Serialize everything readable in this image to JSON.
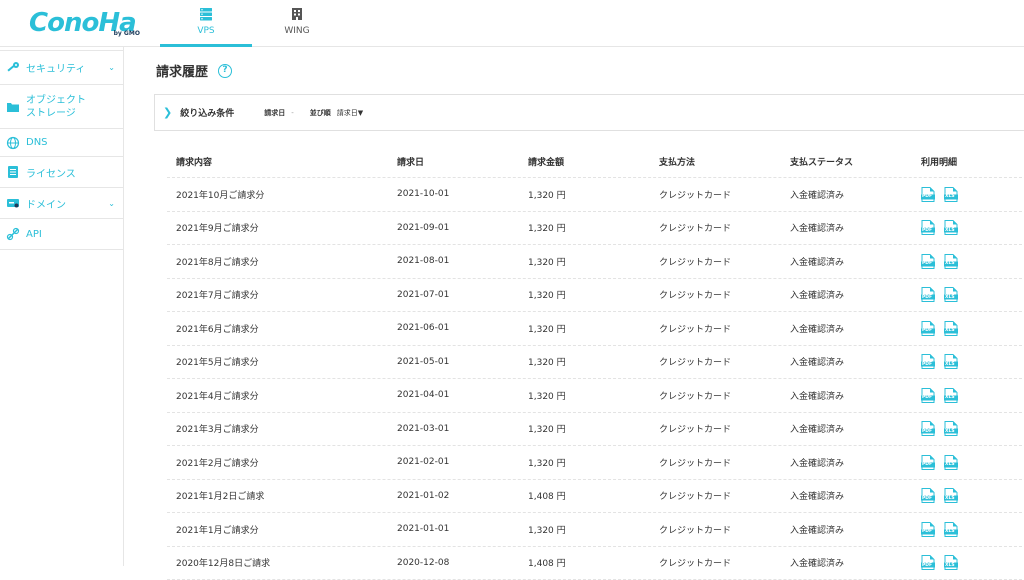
{
  "header": {
    "logo_text": "ConoHa",
    "logo_sub": "by GMO",
    "tabs": [
      {
        "label": "VPS",
        "icon": "server-icon",
        "active": true
      },
      {
        "label": "WING",
        "icon": "building-icon",
        "active": false
      }
    ]
  },
  "sidebar": {
    "items": [
      {
        "label": "セキュリティ",
        "icon": "key-icon",
        "has_chevron": true
      },
      {
        "label_line1": "オブジェクト",
        "label_line2": "ストレージ",
        "icon": "folder-icon"
      },
      {
        "label": "DNS",
        "icon": "globe-icon"
      },
      {
        "label": "ライセンス",
        "icon": "license-icon"
      },
      {
        "label": "ドメイン",
        "icon": "domain-icon",
        "has_chevron": true
      },
      {
        "label": "API",
        "icon": "api-icon"
      }
    ]
  },
  "main": {
    "title": "請求履歴",
    "help": "?",
    "filter": {
      "title": "絞り込み条件",
      "date_label": "請求日",
      "date_value": "-",
      "sort_label": "並び順",
      "sort_value": "請求日▼"
    },
    "table": {
      "headers": [
        "請求内容",
        "請求日",
        "請求金額",
        "支払方法",
        "支払ステータス",
        "利用明細"
      ],
      "rows": [
        [
          "2021年10月ご請求分",
          "2021-10-01",
          "1,320 円",
          "クレジットカード",
          "入金確認済み"
        ],
        [
          "2021年9月ご請求分",
          "2021-09-01",
          "1,320 円",
          "クレジットカード",
          "入金確認済み"
        ],
        [
          "2021年8月ご請求分",
          "2021-08-01",
          "1,320 円",
          "クレジットカード",
          "入金確認済み"
        ],
        [
          "2021年7月ご請求分",
          "2021-07-01",
          "1,320 円",
          "クレジットカード",
          "入金確認済み"
        ],
        [
          "2021年6月ご請求分",
          "2021-06-01",
          "1,320 円",
          "クレジットカード",
          "入金確認済み"
        ],
        [
          "2021年5月ご請求分",
          "2021-05-01",
          "1,320 円",
          "クレジットカード",
          "入金確認済み"
        ],
        [
          "2021年4月ご請求分",
          "2021-04-01",
          "1,320 円",
          "クレジットカード",
          "入金確認済み"
        ],
        [
          "2021年3月ご請求分",
          "2021-03-01",
          "1,320 円",
          "クレジットカード",
          "入金確認済み"
        ],
        [
          "2021年2月ご請求分",
          "2021-02-01",
          "1,320 円",
          "クレジットカード",
          "入金確認済み"
        ],
        [
          "2021年1月2日ご請求",
          "2021-01-02",
          "1,408 円",
          "クレジットカード",
          "入金確認済み"
        ],
        [
          "2021年1月ご請求分",
          "2021-01-01",
          "1,320 円",
          "クレジットカード",
          "入金確認済み"
        ],
        [
          "2020年12月8日ご請求",
          "2020-12-08",
          "1,408 円",
          "クレジットカード",
          "入金確認済み"
        ]
      ],
      "doc_labels": [
        "PDF",
        "XLS"
      ]
    }
  },
  "colors": {
    "accent": "#2bbfd8",
    "text": "#333333",
    "border": "#e6e6e6"
  }
}
